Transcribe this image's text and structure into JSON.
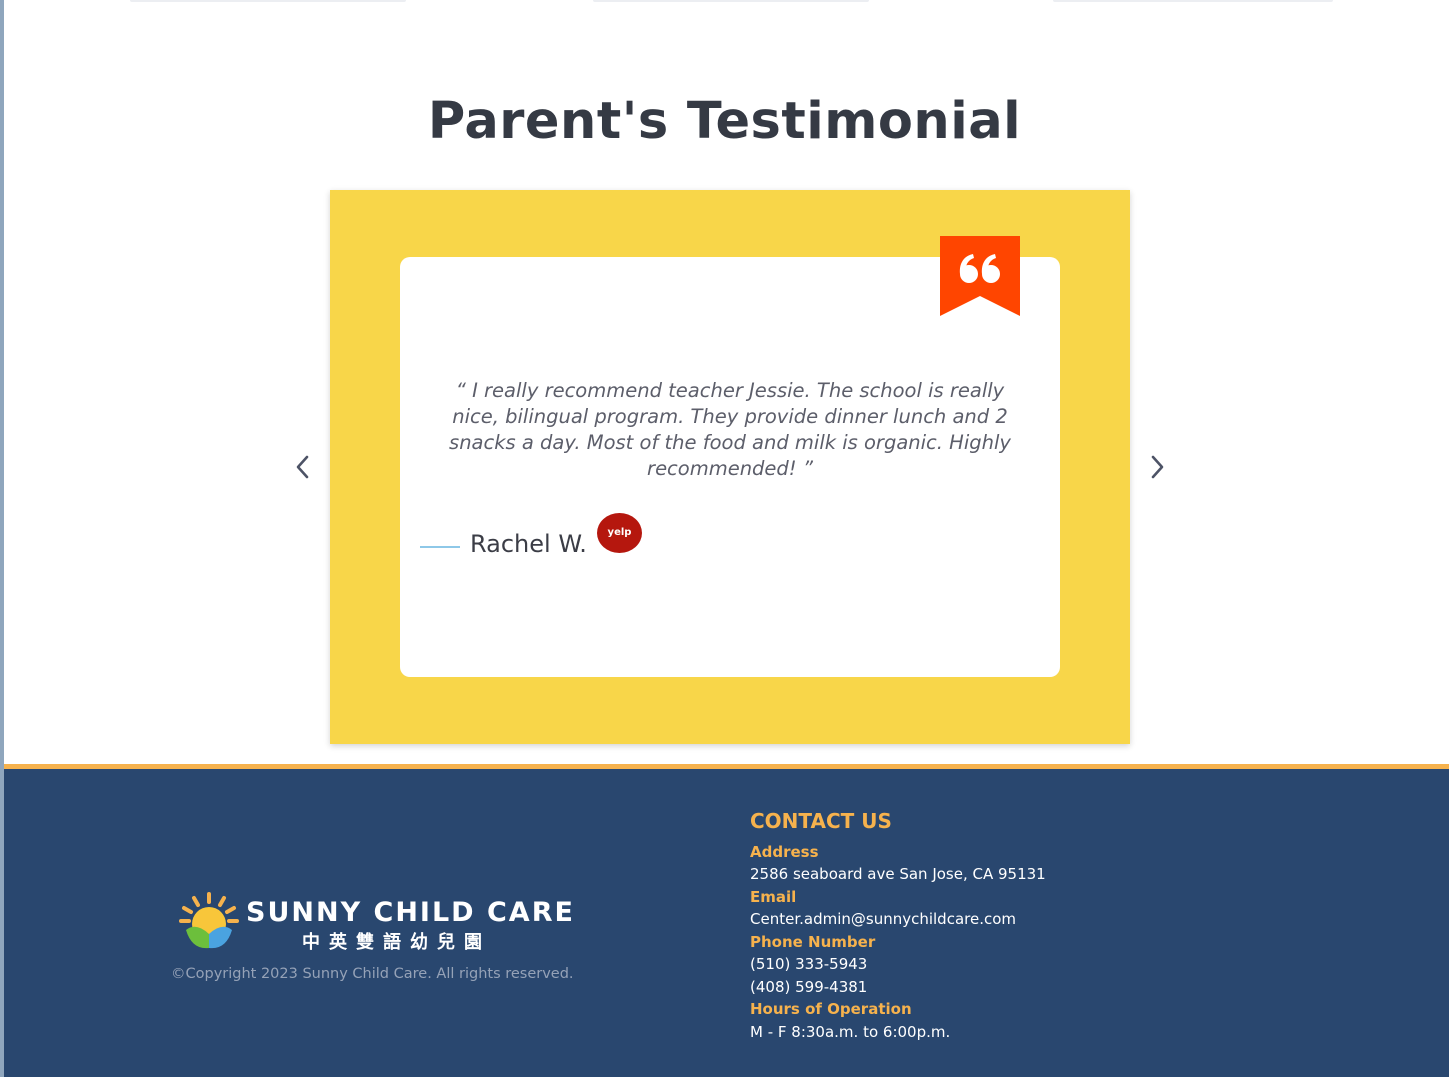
{
  "testimonials": {
    "title": "Parent's Testimonial",
    "quote": "“ I really recommend teacher Jessie. The school is really nice, bilingual program. They provide dinner lunch and 2 snacks a day. Most of the food and milk is organic. Highly recommended! ”",
    "author": "Rachel W.",
    "source_badge": "yelp",
    "quote_icon": "quote-mark-icon",
    "prev_icon": "chevron-left-icon",
    "next_icon": "chevron-right-icon"
  },
  "footer": {
    "logo": {
      "name": "SUNNY CHILD CARE",
      "chinese_name": "中英雙語幼兒園"
    },
    "copyright": "©Copyright 2023 Sunny Child Care. All rights reserved.",
    "contact": {
      "heading": "CONTACT US",
      "address_label": "Address",
      "address": "2586 seaboard ave San Jose, CA 95131",
      "email_label": "Email",
      "email": "Center.admin@sunnychildcare.com",
      "phone_label": "Phone Number",
      "phone_1": "(510) 333-5943",
      "phone_2": "(408) 599-4381",
      "hours_label": "Hours of Operation",
      "hours": "M - F 8:30a.m. to 6:00p.m."
    }
  },
  "colors": {
    "panel": "#f8d649",
    "quote_badge": "#ff4500",
    "footer_bg": "#29476f",
    "footer_accent": "#f6b24d",
    "yelp_red": "#b5170e"
  }
}
